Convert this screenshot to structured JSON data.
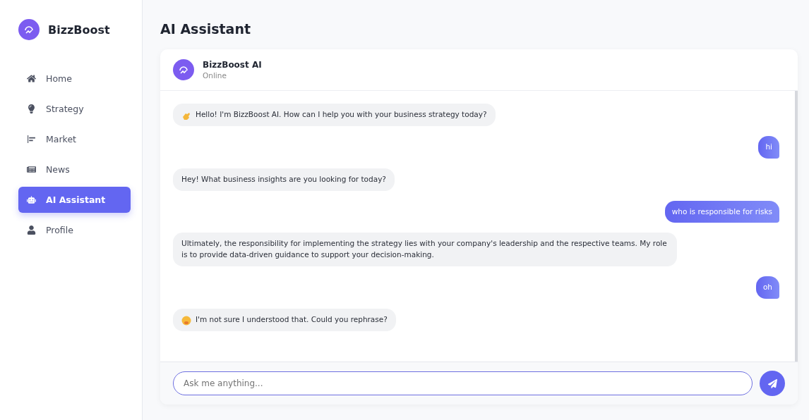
{
  "sidebar": {
    "brand": "BizzBoost",
    "items": [
      {
        "label": "Home",
        "selected": false
      },
      {
        "label": "Strategy",
        "selected": false
      },
      {
        "label": "Market",
        "selected": false
      },
      {
        "label": "News",
        "selected": false
      },
      {
        "label": "AI Assistant",
        "selected": true
      },
      {
        "label": "Profile",
        "selected": false
      }
    ]
  },
  "page_title": "AI Assistant",
  "chat": {
    "name": "BizzBoost AI",
    "status": "Online",
    "messages": [
      {
        "kind": "greeting",
        "text": "Hello! I'm BizzBoost AI. How can I help you with your business strategy today?"
      },
      {
        "kind": "user",
        "text": "hi"
      },
      {
        "kind": "bot",
        "text": "Hey! What business insights are you looking for today?"
      },
      {
        "kind": "user",
        "text": "who is responsible for risks"
      },
      {
        "kind": "bot",
        "text": "Ultimately, the responsibility for implementing the strategy lies with your company's leadership and the respective teams. My role is to provide data-driven guidance to support your decision-making."
      },
      {
        "kind": "user",
        "text": "oh"
      },
      {
        "kind": "confused",
        "text": "I'm not sure I understood that. Could you rephrase?"
      }
    ],
    "input": {
      "placeholder": "Ask me anything..."
    }
  }
}
